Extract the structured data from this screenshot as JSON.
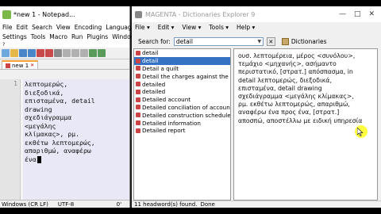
{
  "notepad": {
    "title": "*new 1 - Notepad...",
    "menu_row1": [
      "File",
      "Edit",
      "Search",
      "View",
      "Encoding",
      "Language"
    ],
    "menu_row2": [
      "Settings",
      "Tools",
      "Macro",
      "Run",
      "Plugins",
      "Window"
    ],
    "menu_row3": [
      "?"
    ],
    "tab_label": "new 1",
    "line_number": "1",
    "code_lines": [
      "λεπτομερώς,",
      "διεξοδικά,",
      "επισταμένα, detail",
      "drawing",
      "σχεδιάγραμμα",
      "<μεγάλης",
      "κλίμακας>, ρμ.",
      "εκθέτω λεπτομερώς,",
      "απαριθμώ, αναφέρω",
      "ένα"
    ],
    "status_eol": "Windows (CR LF)",
    "status_encoding": "UTF-8",
    "status_ins": "0'"
  },
  "dictionary": {
    "title": "MAGENTA - Dictionaries Explorer 9",
    "window_controls": [
      "—",
      "□",
      "✕"
    ],
    "menu": [
      "File",
      "Edit",
      "View",
      "Tools",
      "Help"
    ],
    "search_label": "Search for:",
    "search_value": "detail",
    "search_btn": "✕",
    "dictionaries_label": "Dictionaries",
    "words": [
      "detail",
      "detail",
      "Detail a quilt",
      "Detail the charges against the de",
      "detailed",
      "detailed",
      "Detailed account",
      "Detailed conciliation of accounts",
      "Detailed construction schedule",
      "Detailed information",
      "Detailed report"
    ],
    "selected_index": 1,
    "definition_lines": [
      "ουσ. λεπτομέρεια, μέρος <συνόλου>,",
      "τεμάχιο <μηχανής>, ασήμαντο",
      "περιστατικό, [στρατ.] απόσπασμα, in",
      "detail λεπτομερώς, διεξοδικά,",
      "επισταμένα, detail drawing",
      "σχεδιάγραμμα <μεγάλης κλίμακας>,",
      "ρμ. εκθέτω λεπτομερώς, απαριθμώ,",
      "αναφέρω ένα προς ένα, [στρατ.]",
      "αποσπώ, αποστέλλω με ειδική υπηρεσία"
    ],
    "status_text": "11 headword(s) found.",
    "status_done": "Done"
  },
  "colors": {
    "selection": "#3672c3",
    "editor_bg": "#e8e8f6",
    "tab_accent": "#f7a33c",
    "cursor_highlight": "#ffff00"
  }
}
